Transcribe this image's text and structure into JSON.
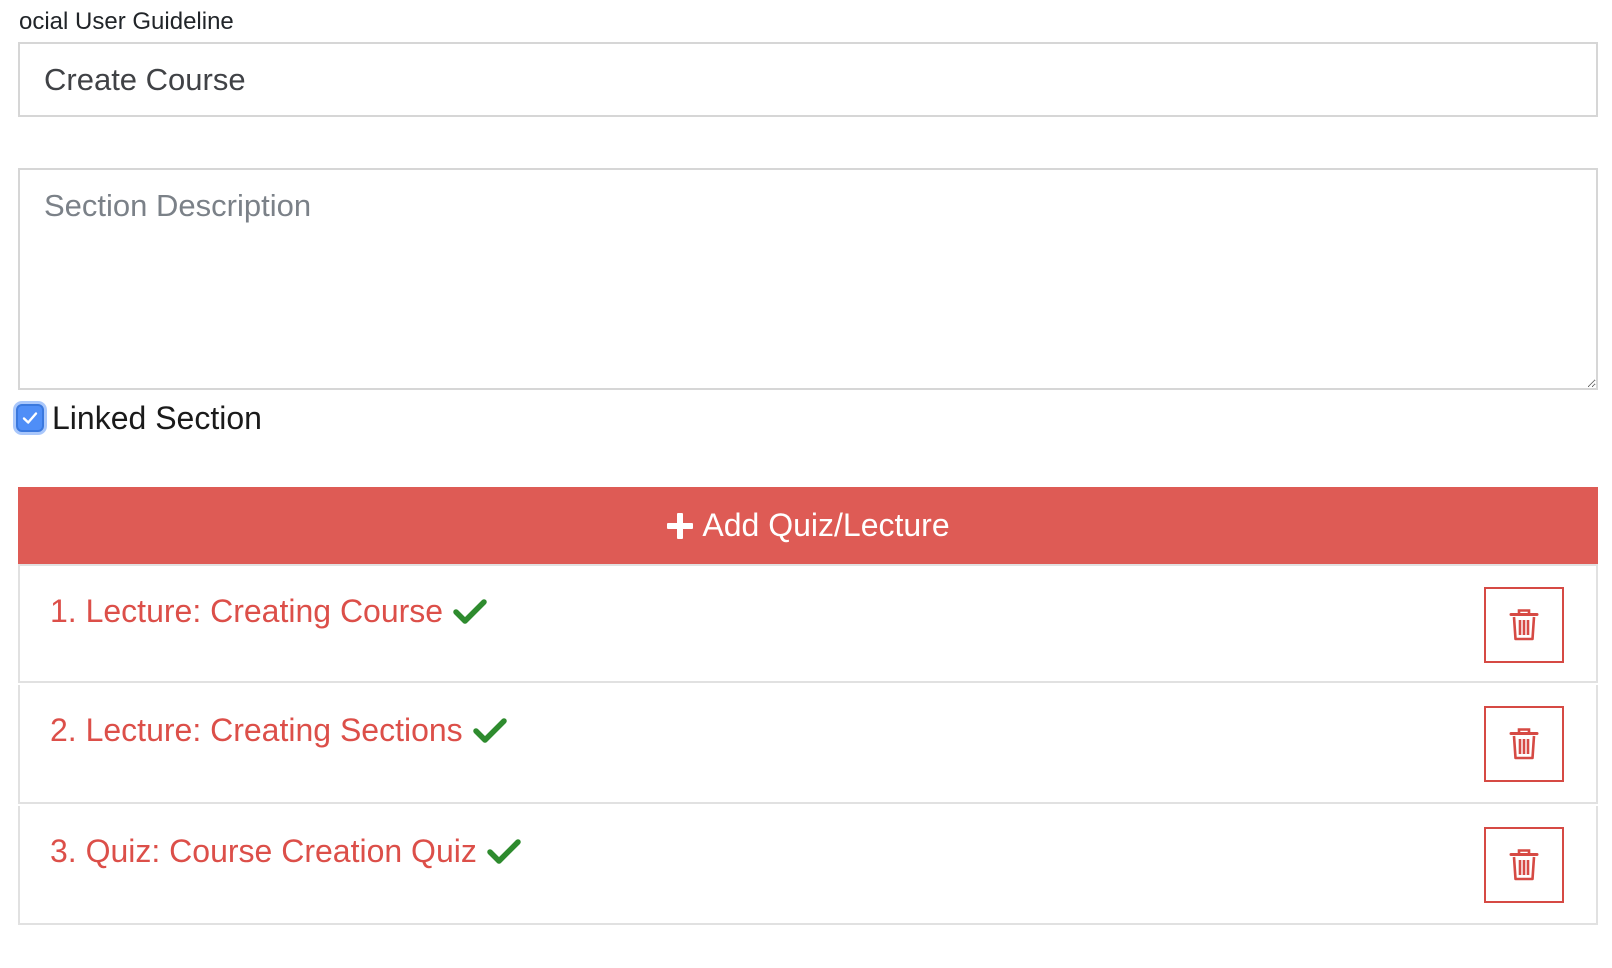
{
  "breadcrumb": "ocial User Guideline",
  "section_title_field": {
    "value": "Create Course"
  },
  "section_description_field": {
    "value": "",
    "placeholder": "Section Description"
  },
  "linked_section": {
    "label": "Linked Section",
    "checked": true
  },
  "add_button": {
    "label": "Add Quiz/Lecture",
    "icon": "plus-icon"
  },
  "items": [
    {
      "label": "1. Lecture: Creating Course",
      "status_icon": "check-icon",
      "action_icon": "trash-icon"
    },
    {
      "label": "2. Lecture: Creating Sections",
      "status_icon": "check-icon",
      "action_icon": "trash-icon"
    },
    {
      "label": "3. Quiz: Course Creation Quiz",
      "status_icon": "check-icon",
      "action_icon": "trash-icon"
    }
  ],
  "colors": {
    "accent_red": "#de5b55",
    "item_text_red": "#dc4f49",
    "check_green": "#2e8b2e",
    "checkbox_blue": "#4f8ef7"
  }
}
